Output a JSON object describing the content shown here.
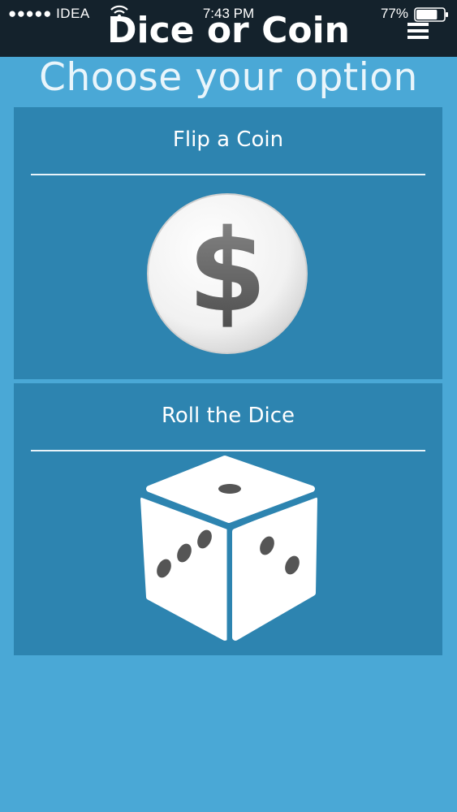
{
  "status_bar": {
    "carrier": "●●●●● IDEA",
    "time": "7:43 PM",
    "battery_percent": "77%",
    "battery_level": 0.77
  },
  "header": {
    "title": "Dice or Coin",
    "menu_icon": "hamburger-menu-icon"
  },
  "main": {
    "heading": "Choose your option",
    "options": [
      {
        "label": "Flip a Coin",
        "icon": "dollar-coin-icon"
      },
      {
        "label": "Roll the Dice",
        "icon": "dice-icon"
      }
    ]
  },
  "colors": {
    "background": "#4aa8d6",
    "card": "#2d84b0",
    "topbar": "#14222c"
  }
}
